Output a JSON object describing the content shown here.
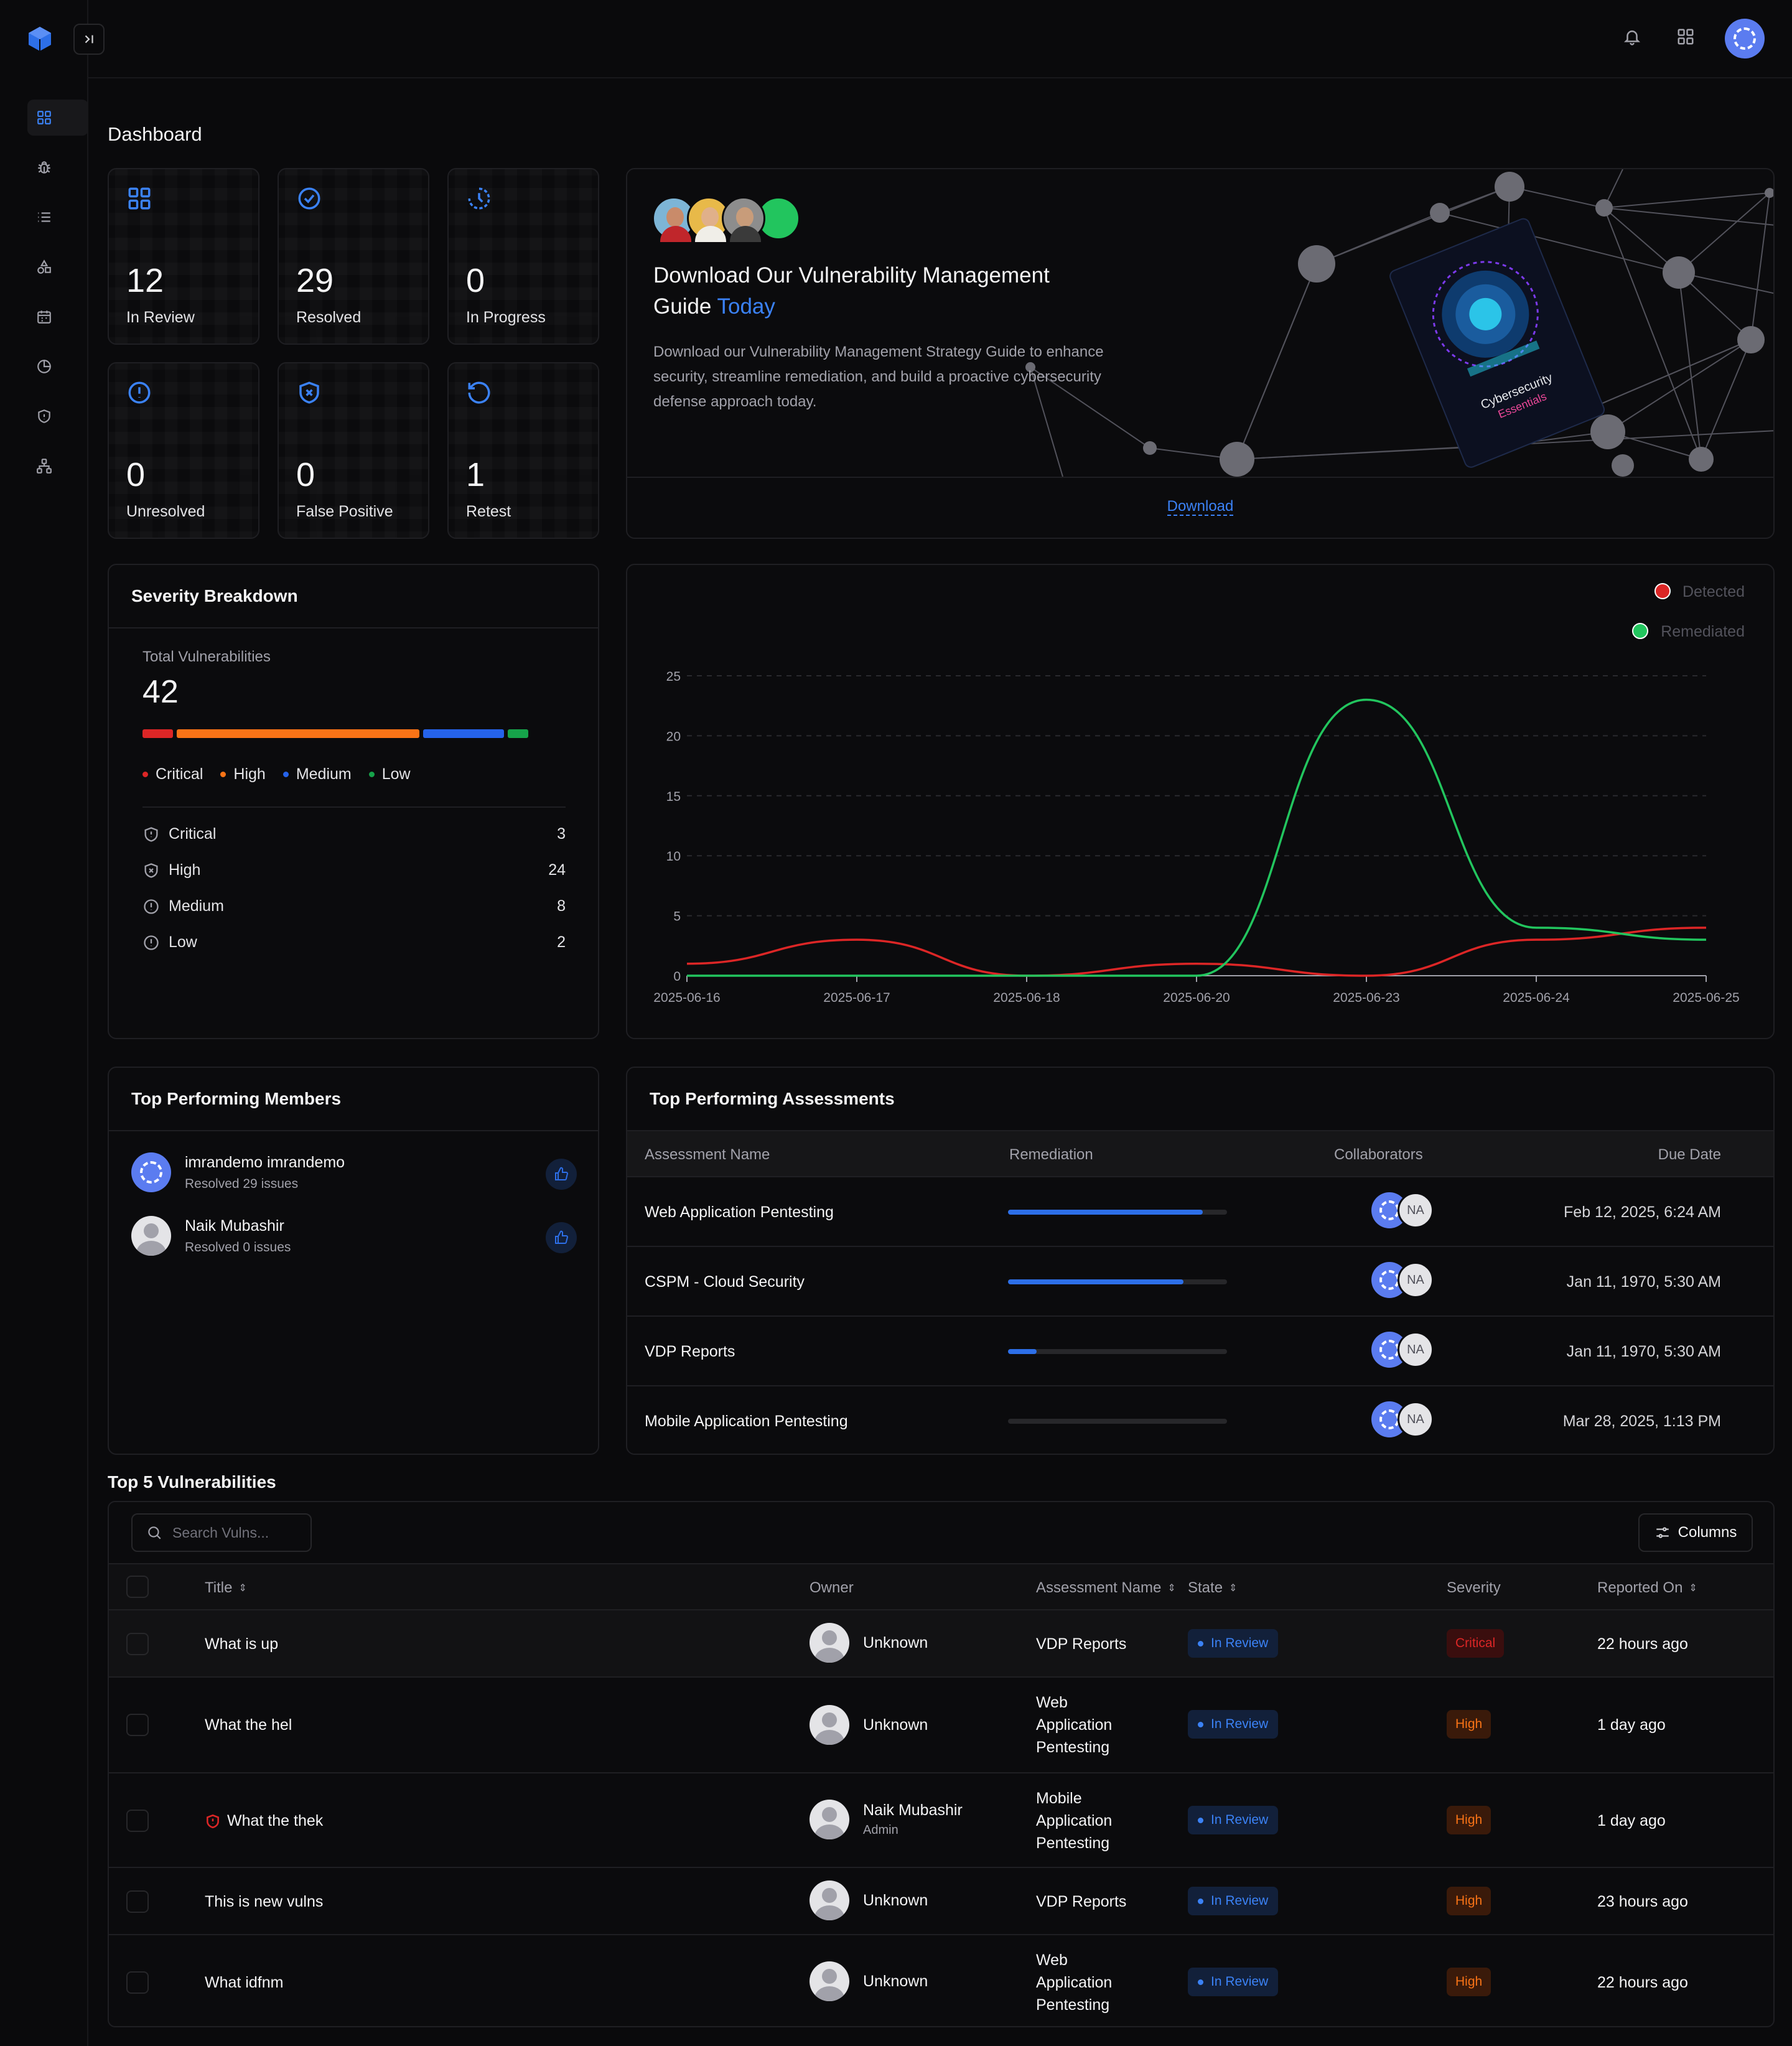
{
  "page": {
    "title": "Dashboard"
  },
  "stats": [
    {
      "value": "12",
      "label": "In Review"
    },
    {
      "value": "29",
      "label": "Resolved"
    },
    {
      "value": "0",
      "label": "In Progress"
    },
    {
      "value": "0",
      "label": "Unresolved"
    },
    {
      "value": "0",
      "label": "False Positive"
    },
    {
      "value": "1",
      "label": "Retest"
    }
  ],
  "promo": {
    "title_line1": "Download Our Vulnerability Management",
    "title_line2": "Guide",
    "title_highlight": "Today",
    "description": "Download our Vulnerability Management Strategy Guide to enhance security, streamline remediation, and build a proactive cybersecurity defense approach today.",
    "download_label": "Download",
    "book_title": "Cybersecurity",
    "book_subtitle": "Essentials"
  },
  "severity": {
    "title": "Severity Breakdown",
    "total_label": "Total Vulnerabilities",
    "total": "42",
    "legend": [
      "Critical",
      "High",
      "Medium",
      "Low"
    ],
    "rows": [
      {
        "label": "Critical",
        "count": "3"
      },
      {
        "label": "High",
        "count": "24"
      },
      {
        "label": "Medium",
        "count": "8"
      },
      {
        "label": "Low",
        "count": "2"
      }
    ],
    "colors": {
      "critical": "#dc2626",
      "high": "#f97316",
      "medium": "#2563eb",
      "low": "#16a34a"
    }
  },
  "chart_data": {
    "type": "line",
    "x": [
      "2025-06-16",
      "2025-06-17",
      "2025-06-18",
      "2025-06-20",
      "2025-06-23",
      "2025-06-24",
      "2025-06-25"
    ],
    "ylim": [
      0,
      25
    ],
    "yticks": [
      "0",
      "5",
      "10",
      "15",
      "20",
      "25"
    ],
    "series": [
      {
        "name": "Detected",
        "color": "#dc2626",
        "values": [
          1,
          3,
          0,
          1,
          0,
          3,
          4
        ]
      },
      {
        "name": "Remediated",
        "color": "#22c55e",
        "values": [
          0,
          0,
          0,
          0,
          23,
          4,
          3
        ]
      }
    ],
    "legend": "top-right",
    "grid": true
  },
  "members": {
    "title": "Top Performing Members",
    "items": [
      {
        "name": "imrandemo imrandemo",
        "sub": "Resolved 29 issues"
      },
      {
        "name": "Naik Mubashir",
        "sub": "Resolved 0 issues"
      }
    ]
  },
  "assessments": {
    "title": "Top Performing Assessments",
    "headers": [
      "Assessment Name",
      "Remediation",
      "Collaborators",
      "Due Date"
    ],
    "rows": [
      {
        "name": "Web Application Pentesting",
        "progress": 0.89,
        "collab": "NA",
        "due": "Feb 12, 2025, 6:24 AM"
      },
      {
        "name": "CSPM - Cloud Security",
        "progress": 0.8,
        "collab": "NA",
        "due": "Jan 11, 1970, 5:30 AM"
      },
      {
        "name": "VDP Reports",
        "progress": 0.13,
        "collab": "NA",
        "due": "Jan 11, 1970, 5:30 AM"
      },
      {
        "name": "Mobile Application Pentesting",
        "progress": 0,
        "collab": "NA",
        "due": "Mar 28, 2025, 1:13 PM"
      }
    ]
  },
  "vulns": {
    "title": "Top 5 Vulnerabilities",
    "search_placeholder": "Search Vulns...",
    "columns_label": "Columns",
    "headers": [
      "Title",
      "Owner",
      "Assessment Name",
      "State",
      "Severity",
      "Reported On"
    ],
    "rows": [
      {
        "title": "What is up",
        "owner": "Unknown",
        "role": "",
        "assessment": "VDP Reports",
        "state": "In Review",
        "severity": "Critical",
        "reported": "22 hours ago"
      },
      {
        "title": "What the hel",
        "owner": "Unknown",
        "role": "",
        "assessment": "Web Application Pentesting",
        "state": "In Review",
        "severity": "High",
        "reported": "1 day ago"
      },
      {
        "title": "What the thek",
        "owner": "Naik Mubashir",
        "role": "Admin",
        "assessment": "Mobile Application Pentesting",
        "state": "In Review",
        "severity": "High",
        "reported": "1 day ago"
      },
      {
        "title": "This is new vulns",
        "owner": "Unknown",
        "role": "",
        "assessment": "VDP Reports",
        "state": "In Review",
        "severity": "High",
        "reported": "23 hours ago"
      },
      {
        "title": "What idfnm",
        "owner": "Unknown",
        "role": "",
        "assessment": "Web Application Pentesting",
        "state": "In Review",
        "severity": "High",
        "reported": "22 hours ago"
      }
    ]
  }
}
